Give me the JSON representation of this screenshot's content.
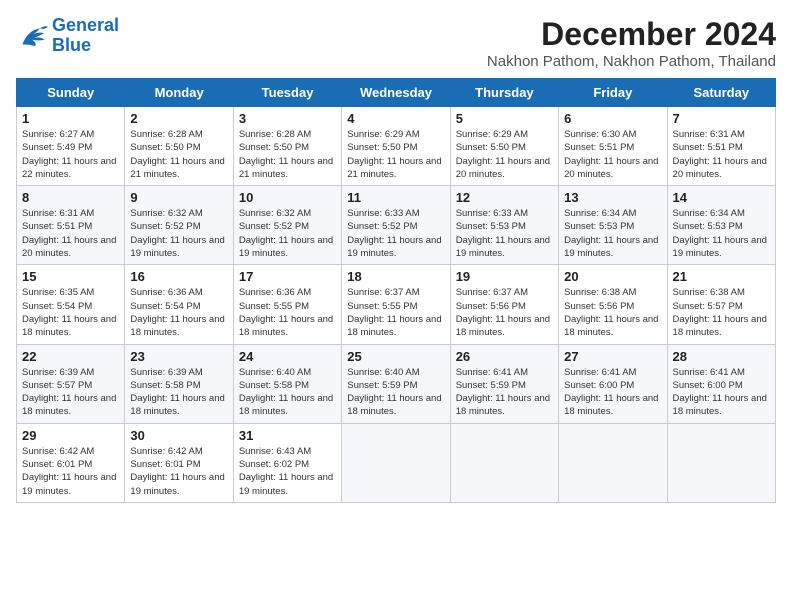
{
  "logo": {
    "line1": "General",
    "line2": "Blue"
  },
  "title": "December 2024",
  "subtitle": "Nakhon Pathom, Nakhon Pathom, Thailand",
  "days_header": [
    "Sunday",
    "Monday",
    "Tuesday",
    "Wednesday",
    "Thursday",
    "Friday",
    "Saturday"
  ],
  "weeks": [
    [
      {
        "day": "1",
        "sunrise": "6:27 AM",
        "sunset": "5:49 PM",
        "daylight": "11 hours and 22 minutes."
      },
      {
        "day": "2",
        "sunrise": "6:28 AM",
        "sunset": "5:50 PM",
        "daylight": "11 hours and 21 minutes."
      },
      {
        "day": "3",
        "sunrise": "6:28 AM",
        "sunset": "5:50 PM",
        "daylight": "11 hours and 21 minutes."
      },
      {
        "day": "4",
        "sunrise": "6:29 AM",
        "sunset": "5:50 PM",
        "daylight": "11 hours and 21 minutes."
      },
      {
        "day": "5",
        "sunrise": "6:29 AM",
        "sunset": "5:50 PM",
        "daylight": "11 hours and 20 minutes."
      },
      {
        "day": "6",
        "sunrise": "6:30 AM",
        "sunset": "5:51 PM",
        "daylight": "11 hours and 20 minutes."
      },
      {
        "day": "7",
        "sunrise": "6:31 AM",
        "sunset": "5:51 PM",
        "daylight": "11 hours and 20 minutes."
      }
    ],
    [
      {
        "day": "8",
        "sunrise": "6:31 AM",
        "sunset": "5:51 PM",
        "daylight": "11 hours and 20 minutes."
      },
      {
        "day": "9",
        "sunrise": "6:32 AM",
        "sunset": "5:52 PM",
        "daylight": "11 hours and 19 minutes."
      },
      {
        "day": "10",
        "sunrise": "6:32 AM",
        "sunset": "5:52 PM",
        "daylight": "11 hours and 19 minutes."
      },
      {
        "day": "11",
        "sunrise": "6:33 AM",
        "sunset": "5:52 PM",
        "daylight": "11 hours and 19 minutes."
      },
      {
        "day": "12",
        "sunrise": "6:33 AM",
        "sunset": "5:53 PM",
        "daylight": "11 hours and 19 minutes."
      },
      {
        "day": "13",
        "sunrise": "6:34 AM",
        "sunset": "5:53 PM",
        "daylight": "11 hours and 19 minutes."
      },
      {
        "day": "14",
        "sunrise": "6:34 AM",
        "sunset": "5:53 PM",
        "daylight": "11 hours and 19 minutes."
      }
    ],
    [
      {
        "day": "15",
        "sunrise": "6:35 AM",
        "sunset": "5:54 PM",
        "daylight": "11 hours and 18 minutes."
      },
      {
        "day": "16",
        "sunrise": "6:36 AM",
        "sunset": "5:54 PM",
        "daylight": "11 hours and 18 minutes."
      },
      {
        "day": "17",
        "sunrise": "6:36 AM",
        "sunset": "5:55 PM",
        "daylight": "11 hours and 18 minutes."
      },
      {
        "day": "18",
        "sunrise": "6:37 AM",
        "sunset": "5:55 PM",
        "daylight": "11 hours and 18 minutes."
      },
      {
        "day": "19",
        "sunrise": "6:37 AM",
        "sunset": "5:56 PM",
        "daylight": "11 hours and 18 minutes."
      },
      {
        "day": "20",
        "sunrise": "6:38 AM",
        "sunset": "5:56 PM",
        "daylight": "11 hours and 18 minutes."
      },
      {
        "day": "21",
        "sunrise": "6:38 AM",
        "sunset": "5:57 PM",
        "daylight": "11 hours and 18 minutes."
      }
    ],
    [
      {
        "day": "22",
        "sunrise": "6:39 AM",
        "sunset": "5:57 PM",
        "daylight": "11 hours and 18 minutes."
      },
      {
        "day": "23",
        "sunrise": "6:39 AM",
        "sunset": "5:58 PM",
        "daylight": "11 hours and 18 minutes."
      },
      {
        "day": "24",
        "sunrise": "6:40 AM",
        "sunset": "5:58 PM",
        "daylight": "11 hours and 18 minutes."
      },
      {
        "day": "25",
        "sunrise": "6:40 AM",
        "sunset": "5:59 PM",
        "daylight": "11 hours and 18 minutes."
      },
      {
        "day": "26",
        "sunrise": "6:41 AM",
        "sunset": "5:59 PM",
        "daylight": "11 hours and 18 minutes."
      },
      {
        "day": "27",
        "sunrise": "6:41 AM",
        "sunset": "6:00 PM",
        "daylight": "11 hours and 18 minutes."
      },
      {
        "day": "28",
        "sunrise": "6:41 AM",
        "sunset": "6:00 PM",
        "daylight": "11 hours and 18 minutes."
      }
    ],
    [
      {
        "day": "29",
        "sunrise": "6:42 AM",
        "sunset": "6:01 PM",
        "daylight": "11 hours and 19 minutes."
      },
      {
        "day": "30",
        "sunrise": "6:42 AM",
        "sunset": "6:01 PM",
        "daylight": "11 hours and 19 minutes."
      },
      {
        "day": "31",
        "sunrise": "6:43 AM",
        "sunset": "6:02 PM",
        "daylight": "11 hours and 19 minutes."
      },
      null,
      null,
      null,
      null
    ]
  ]
}
